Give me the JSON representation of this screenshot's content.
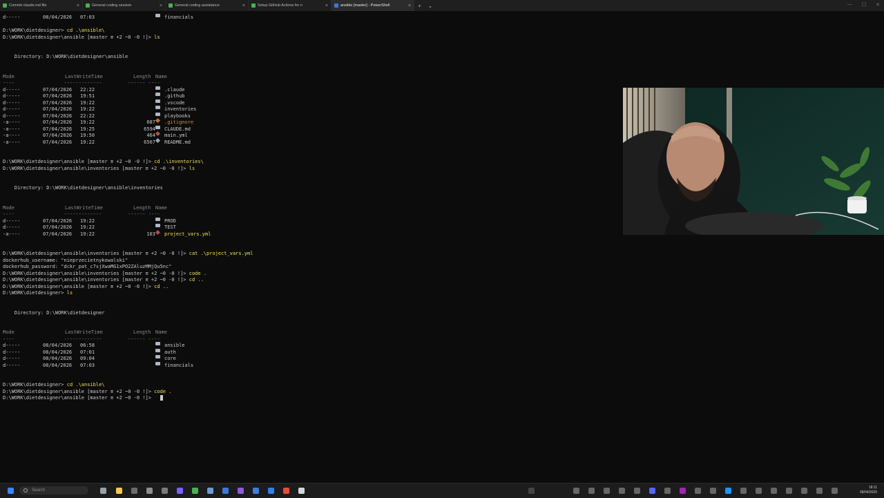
{
  "tabs": [
    {
      "label": "Commit claude.md file",
      "color": "#4caf50"
    },
    {
      "label": "General coding session",
      "color": "#4caf50"
    },
    {
      "label": "General coding assistance",
      "color": "#4caf50"
    },
    {
      "label": "Setup GitHub Actions for n",
      "color": "#4caf50"
    },
    {
      "label": "ansible [master] - PowerShell",
      "color": "#3a7bd5"
    }
  ],
  "tabbar": {
    "new_tab": "+",
    "dropdown": "⌄"
  },
  "terminal": {
    "lines": [
      {
        "mode": "d-----",
        "date": "08/04/2026",
        "time": "07:03",
        "length": "",
        "icon": "dir",
        "name": "financials"
      },
      {
        "blank": true
      },
      {
        "prompt": "D:\\WORK\\dietdesigner>",
        "cmd": "cd .\\ansible\\"
      },
      {
        "prompt": "D:\\WORK\\dietdesigner\\ansible [master ≡ +2 ~0 -0 !]>",
        "cmd": "ls"
      },
      {
        "blank": true
      },
      {
        "blank": true
      },
      {
        "text": "    Directory: D:\\WORK\\dietdesigner\\ansible"
      },
      {
        "blank": true
      },
      {
        "blank": true
      },
      {
        "header": true
      },
      {
        "underline": true
      },
      {
        "mode": "d-----",
        "date": "07/04/2026",
        "time": "22:22",
        "length": "",
        "icon": "dir",
        "name": ".claude"
      },
      {
        "mode": "d-----",
        "date": "07/04/2026",
        "time": "19:51",
        "length": "",
        "icon": "dir",
        "name": ".github"
      },
      {
        "mode": "d-----",
        "date": "07/04/2026",
        "time": "19:22",
        "length": "",
        "icon": "dir",
        "name": ".vscode"
      },
      {
        "mode": "d-----",
        "date": "07/04/2026",
        "time": "19:22",
        "length": "",
        "icon": "dir",
        "name": "inventories"
      },
      {
        "mode": "d-----",
        "date": "07/04/2026",
        "time": "22:22",
        "length": "",
        "icon": "dir",
        "name": "playbooks"
      },
      {
        "mode": "-a----",
        "date": "07/04/2026",
        "time": "19:22",
        "length": "687",
        "icon": "git",
        "name": ".gitignore",
        "name_class": "c-orange"
      },
      {
        "mode": "-a----",
        "date": "07/04/2026",
        "time": "19:25",
        "length": "6594",
        "icon": "dir",
        "name": "CLAUDE.md"
      },
      {
        "mode": "-a----",
        "date": "07/04/2026",
        "time": "19:50",
        "length": "464",
        "icon": "yml",
        "name": "main.yml"
      },
      {
        "mode": "-a----",
        "date": "07/04/2026",
        "time": "19:22",
        "length": "6567",
        "icon": "file",
        "name": "README.md"
      },
      {
        "blank": true
      },
      {
        "blank": true
      },
      {
        "prompt": "D:\\WORK\\dietdesigner\\ansible [master ≡ +2 ~0 -0 !]>",
        "cmd": "cd .\\inventories\\"
      },
      {
        "prompt": "D:\\WORK\\dietdesigner\\ansible\\inventories [master ≡ +2 ~0 -0 !]>",
        "cmd": "ls"
      },
      {
        "blank": true
      },
      {
        "blank": true
      },
      {
        "text": "    Directory: D:\\WORK\\dietdesigner\\ansible\\inventories"
      },
      {
        "blank": true
      },
      {
        "blank": true
      },
      {
        "header": true
      },
      {
        "underline": true
      },
      {
        "mode": "d-----",
        "date": "07/04/2026",
        "time": "19:22",
        "length": "",
        "icon": "dir",
        "name": "PROD"
      },
      {
        "mode": "d-----",
        "date": "07/04/2026",
        "time": "19:22",
        "length": "",
        "icon": "dir",
        "name": "TEST"
      },
      {
        "mode": "-a----",
        "date": "07/04/2026",
        "time": "19:22",
        "length": "103",
        "icon": "yml",
        "name": "project_vars.yml",
        "name_class": "c-yellow"
      },
      {
        "blank": true
      },
      {
        "blank": true
      },
      {
        "prompt": "D:\\WORK\\dietdesigner\\ansible\\inventories [master ≡ +2 ~0 -0 !]>",
        "cmd": "cat .\\project_vars.yml"
      },
      {
        "text": "dockerhub_username: \"nieprzecietnykowalski\""
      },
      {
        "text": "dockerhub_password: \"dckr_pat_c7sjXwaMG1xPO2ZAluzMMjQu5nc\""
      },
      {
        "prompt": "D:\\WORK\\dietdesigner\\ansible\\inventories [master ≡ +2 ~0 -0 !]>",
        "cmd": "code ."
      },
      {
        "prompt": "D:\\WORK\\dietdesigner\\ansible\\inventories [master ≡ +2 ~0 -0 !]>",
        "cmd": "cd .."
      },
      {
        "prompt": "D:\\WORK\\dietdesigner\\ansible [master ≡ +2 ~0 -0 !]>",
        "cmd": "cd .."
      },
      {
        "prompt": "D:\\WORK\\dietdesigner>",
        "cmd": "ls"
      },
      {
        "blank": true
      },
      {
        "blank": true
      },
      {
        "text": "    Directory: D:\\WORK\\dietdesigner"
      },
      {
        "blank": true
      },
      {
        "blank": true
      },
      {
        "header": true
      },
      {
        "underline": true
      },
      {
        "mode": "d-----",
        "date": "08/04/2026",
        "time": "06:58",
        "length": "",
        "icon": "dir",
        "name": "ansible"
      },
      {
        "mode": "d-----",
        "date": "08/04/2026",
        "time": "07:01",
        "length": "",
        "icon": "dir",
        "name": "auth"
      },
      {
        "mode": "d-----",
        "date": "08/04/2026",
        "time": "09:04",
        "length": "",
        "icon": "dir",
        "name": "core"
      },
      {
        "mode": "d-----",
        "date": "08/04/2026",
        "time": "07:03",
        "length": "",
        "icon": "dir",
        "name": "financials"
      },
      {
        "blank": true
      },
      {
        "blank": true
      },
      {
        "prompt": "D:\\WORK\\dietdesigner>",
        "cmd": "cd .\\ansible\\"
      },
      {
        "prompt": "D:\\WORK\\dietdesigner\\ansible [master ≡ +2 ~0 -0 !]>",
        "cmd": "code ."
      },
      {
        "prompt": "D:\\WORK\\dietdesigner\\ansible [master ≡ +2 ~0 -0 !]>",
        "cmd": ""
      }
    ],
    "columns": {
      "mode": "Mode",
      "lastwrite": "LastWriteTime",
      "length": "Length",
      "name": "Name"
    }
  },
  "taskbar": {
    "search_placeholder": "Search",
    "clock_time": "18:11",
    "clock_date": "08/04/2026"
  }
}
